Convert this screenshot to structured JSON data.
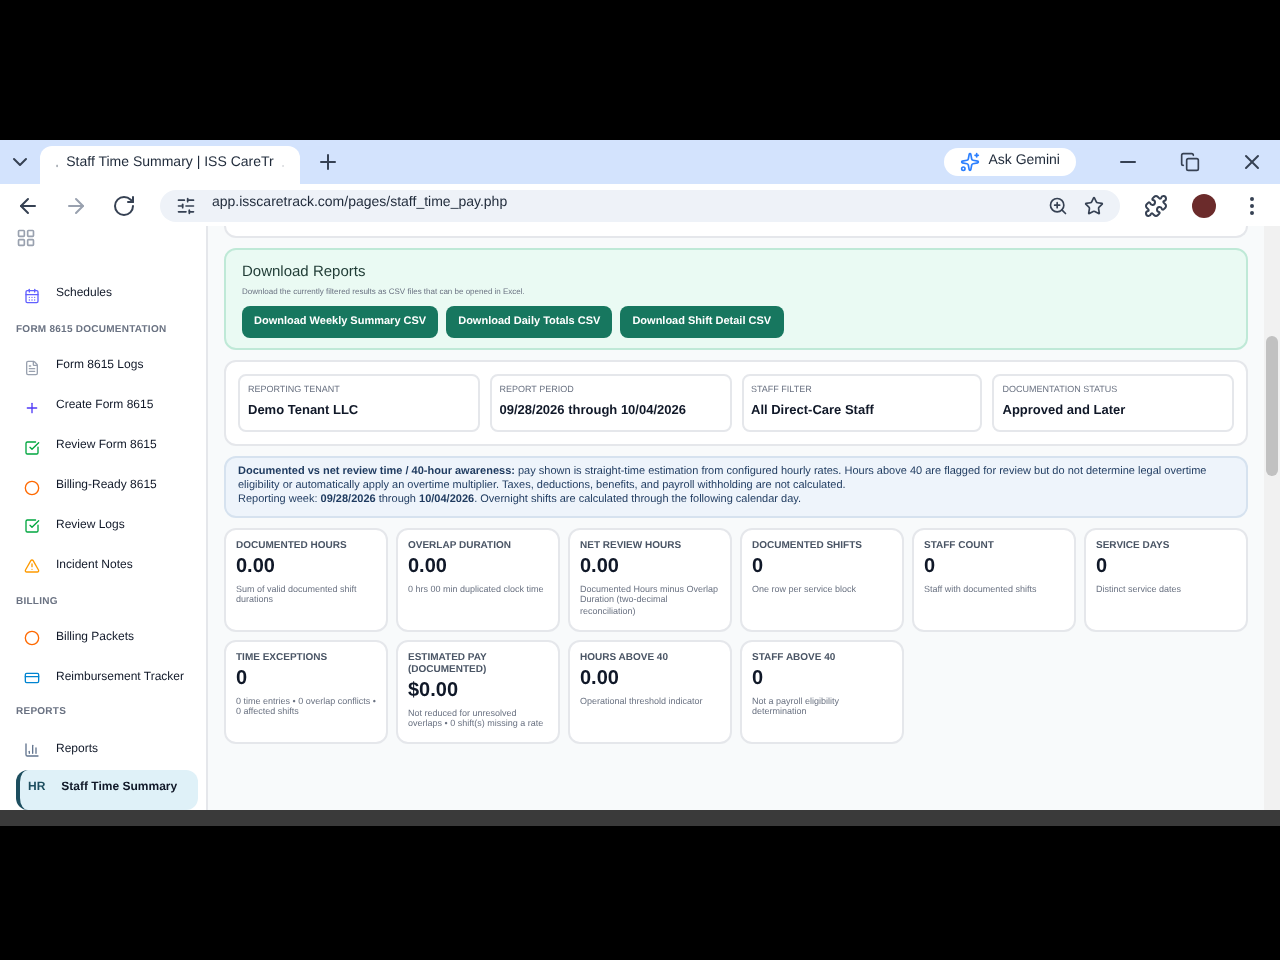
{
  "browser": {
    "tab_title": "Staff Time Summary | ISS CareTr",
    "ask_label": "Ask Gemini",
    "url": "app.isscaretrack.com/pages/staff_time_pay.php"
  },
  "sidebar": {
    "items": [
      {
        "kind": "link",
        "label": "Schedules",
        "selected": false
      },
      {
        "kind": "section",
        "label": "FORM 8615 DOCUMENTATION"
      },
      {
        "kind": "link",
        "label": "Form 8615 Logs",
        "selected": false
      },
      {
        "kind": "link",
        "label": "Create Form 8615",
        "selected": false
      },
      {
        "kind": "link",
        "label": "Review Form 8615",
        "selected": false
      },
      {
        "kind": "link",
        "label": "Billing-Ready 8615",
        "selected": false
      },
      {
        "kind": "link",
        "label": "Review Logs",
        "selected": false
      },
      {
        "kind": "link",
        "label": "Incident Notes",
        "selected": false
      },
      {
        "kind": "section",
        "label": "BILLING"
      },
      {
        "kind": "link",
        "label": "Billing Packets",
        "selected": false
      },
      {
        "kind": "link",
        "label": "Reimbursement Tracker",
        "selected": false
      },
      {
        "kind": "section",
        "label": "REPORTS"
      },
      {
        "kind": "link",
        "label": "Reports",
        "selected": false
      },
      {
        "kind": "link",
        "label": "Staff Time Summary",
        "badge": "HR",
        "selected": true
      }
    ]
  },
  "download": {
    "title": "Download Reports",
    "description": "Download the currently filtered results as CSV files that can be opened in Excel.",
    "buttons": [
      "Download Weekly Summary CSV",
      "Download Daily Totals CSV",
      "Download Shift Detail CSV"
    ]
  },
  "info_cards": [
    {
      "label": "REPORTING TENANT",
      "value": "Demo Tenant LLC"
    },
    {
      "label": "REPORT PERIOD",
      "value": "09/28/2026 through 10/04/2026"
    },
    {
      "label": "STAFF FILTER",
      "value": "All Direct-Care Staff"
    },
    {
      "label": "DOCUMENTATION STATUS",
      "value": "Approved and Later"
    }
  ],
  "notice": {
    "lines": [
      "**Documented vs net review time / 40-hour awareness:** pay shown is straight-time estimation from configured hourly rates. Hours above 40 are flagged for review but do not determine legal overtime eligibility or automatically apply an overtime multiplier. Taxes, deductions, benefits, and payroll withholding are not calculated.",
      "Reporting week: **09/28/2026** through **10/04/2026**. Overnight shifts are calculated through the following calendar day."
    ]
  },
  "stats": [
    {
      "label": "DOCUMENTED HOURS",
      "value": "0.00",
      "note": "Sum of valid documented shift durations"
    },
    {
      "label": "OVERLAP DURATION",
      "value": "0.00",
      "note": "0 hrs 00 min duplicated clock time"
    },
    {
      "label": "NET REVIEW HOURS",
      "value": "0.00",
      "note": "Documented Hours minus Overlap Duration (two-decimal reconciliation)"
    },
    {
      "label": "DOCUMENTED SHIFTS",
      "value": "0",
      "note": "One row per service block"
    },
    {
      "label": "STAFF COUNT",
      "value": "0",
      "note": "Staff with documented shifts"
    },
    {
      "label": "SERVICE DAYS",
      "value": "0",
      "note": "Distinct service dates"
    },
    {
      "label": "TIME EXCEPTIONS",
      "value": "0",
      "note": "0 time entries • 0 overlap conflicts • 0 affected shifts"
    },
    {
      "label": "ESTIMATED PAY (DOCUMENTED)",
      "value": "$0.00",
      "note": "Not reduced for unresolved overlaps • 0 shift(s) missing a rate"
    },
    {
      "label": "HOURS ABOVE 40",
      "value": "0.00",
      "note": "Operational threshold indicator"
    },
    {
      "label": "STAFF ABOVE 40",
      "value": "0",
      "note": "Not a payroll eligibility determination"
    }
  ]
}
